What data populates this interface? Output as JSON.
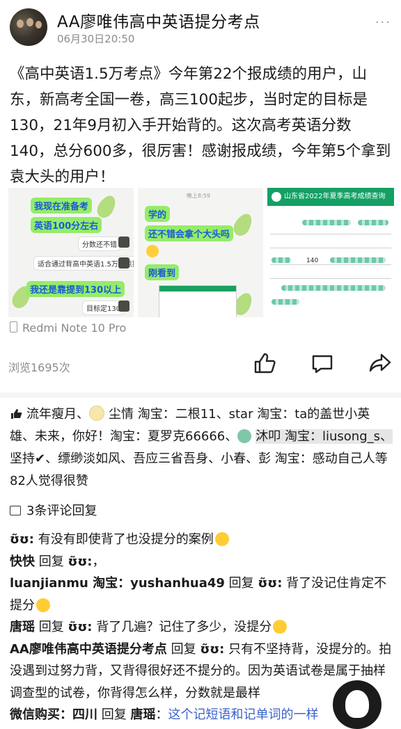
{
  "header": {
    "title": "AA廖唯伟高中英语提分考点",
    "date": "06月30日20:50",
    "more_label": "···"
  },
  "post": {
    "text": "《高中英语1.5万考点》今年第22个报成绩的用户，山东，新高考全国一卷，高三100起步，当时定的目标是130，21年9月初入手开始背的。这次高考英语分数140，总分600多，很厉害！感谢报成绩，今年第5个拿到袁大头的用户！"
  },
  "photos": {
    "chat1": {
      "b1": "我现在准备考",
      "b2": "英语100分左右",
      "b3": "分数还不错",
      "b4": "适合通过背高中英语1.5万考点提分",
      "b5": "我还是靠提到130以上",
      "b6": "目标定130"
    },
    "chat2": {
      "top": "晚上8:59",
      "b1": "学的",
      "b2": "还不错会拿个大头吗",
      "b3": "刚看到"
    },
    "sheet": {
      "title": "山东省2022年夏季高考成绩查询",
      "score": "140"
    }
  },
  "device": {
    "label": "Redmi Note 10 Pro"
  },
  "stats": {
    "views": "浏览1695次"
  },
  "likes": {
    "text_a": "流年瘦月、",
    "text_b": "尘情 淘宝：二根11、star 淘宝：ta的盖世小英雄、未来，你好！淘宝：夏罗克66666、",
    "text_hl": "沐叩 淘宝：liusong_s、",
    "text_c": "坚持✔、缥缈淡如风、吾应三省吾身、小春、彭 淘宝：感动自己人等82人觉得很赞"
  },
  "replies": {
    "count_label": "3条评论回复"
  },
  "comments": [
    {
      "user": "ʊ̃ʊ:",
      "body": " 有没有即使背了也没提分的案例"
    },
    {
      "user": "快快",
      "reply": " 回复 ",
      "target": "ʊ̃ʊ:",
      "body": "，"
    },
    {
      "user": "luanjianmu 淘宝：yushanhua49",
      "reply": " 回复 ",
      "target": "ʊ̃ʊ:",
      "body": " 背了没记住肯定不提分"
    },
    {
      "user": "唐瑶",
      "reply": " 回复 ",
      "target": "ʊ̃ʊ:",
      "body": " 背了几遍？记住了多少，没提分"
    },
    {
      "user": "AA廖唯伟高中英语提分考点",
      "reply": " 回复 ",
      "target": "ʊ̃ʊ:",
      "body": " 只有不坚持背，没提分的。拍没遇到过努力背，又背得很好还不提分的。因为英语试卷是属于抽样调查型的试卷，你背得怎么样，分数就是最样"
    },
    {
      "user": "微信购买：四川",
      "reply": " 回复 ",
      "target": "唐瑶",
      "body": "：",
      "link": "这个记短语和记单词的一样"
    }
  ],
  "colors": {
    "accent_green": "#95ec69",
    "link_blue": "#3a63c8",
    "sheet_green": "#14a065"
  }
}
